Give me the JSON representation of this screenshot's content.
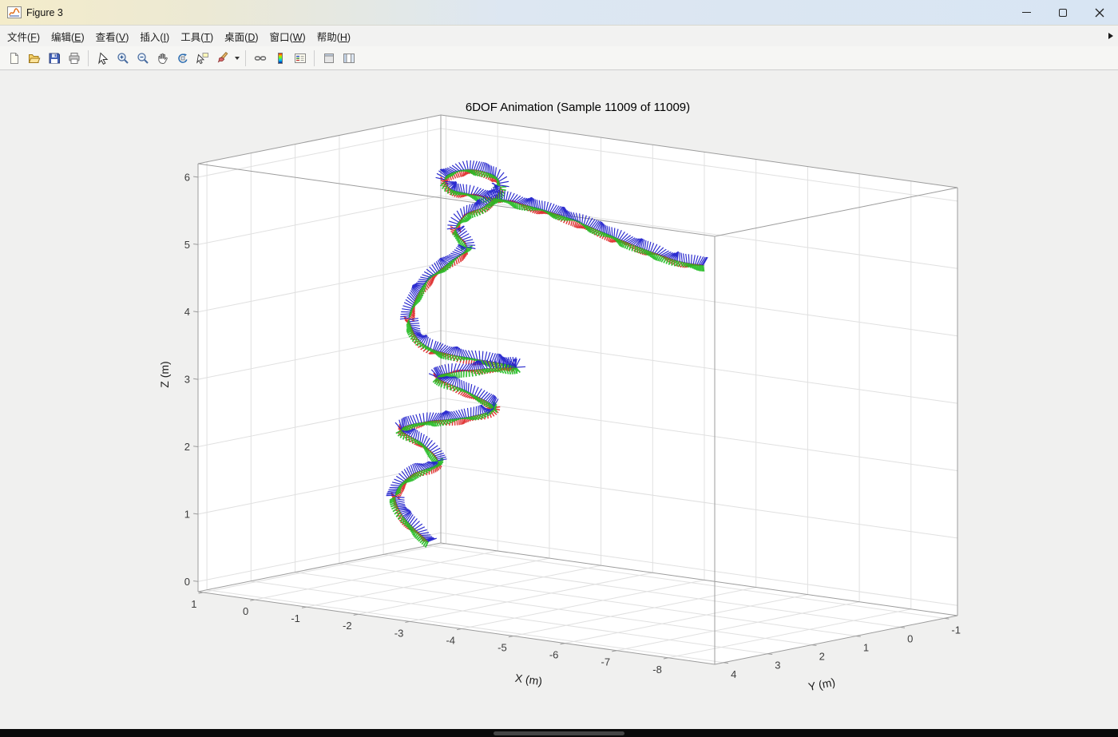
{
  "window": {
    "title": "Figure 3",
    "controls": [
      "minimize",
      "maximize",
      "close"
    ]
  },
  "menu_bar": {
    "items": [
      {
        "label": "文件(F)"
      },
      {
        "label": "编辑(E)"
      },
      {
        "label": "查看(V)"
      },
      {
        "label": "插入(I)"
      },
      {
        "label": "工具(T)"
      },
      {
        "label": "桌面(D)"
      },
      {
        "label": "窗口(W)"
      },
      {
        "label": "帮助(H)"
      }
    ]
  },
  "toolbar": {
    "icons": [
      "new-figure",
      "open-file",
      "save-figure",
      "print-figure",
      "edit-plot",
      "zoom-in",
      "zoom-out",
      "pan",
      "rotate-3d",
      "data-cursor",
      "brush-data",
      "link-plot",
      "insert-colorbar",
      "insert-legend",
      "hide-plot-tools",
      "show-plot-tools"
    ]
  },
  "colors": {
    "titlebar_gradient_left": "#f4ecca",
    "titlebar_gradient_right": "#d8e5f3",
    "figure_background": "#f0f0ef",
    "axes_background": "#ffffff",
    "grid": "#e0e0e0"
  },
  "chart_data": {
    "type": "scatter",
    "subtype": "3d-pose-trail",
    "title": "6DOF Animation (Sample 11009 of 11009)",
    "sample_current": 11009,
    "sample_total": 11009,
    "xlabel": "X (m)",
    "ylabel": "Y (m)",
    "zlabel": "Z (m)",
    "xlim": [
      1.1,
      -8.9
    ],
    "ylim": [
      4.2,
      -1.3
    ],
    "zlim": [
      -0.15,
      6.2
    ],
    "x_ticks": [
      1,
      0,
      -1,
      -2,
      -3,
      -4,
      -5,
      -6,
      -7,
      -8
    ],
    "y_ticks": [
      4,
      3,
      2,
      1,
      0,
      -1
    ],
    "z_ticks": [
      0,
      1,
      2,
      3,
      4,
      5,
      6
    ],
    "grid": true,
    "view": "MATLAB default 3D (az -37.5, el 30)",
    "legend": "none",
    "axes_colors": {
      "x_triad": "#dd2222",
      "y_triad": "#22bb22",
      "z_triad": "#2222cc"
    },
    "trajectory": [
      [
        -0.83,
        1.23,
        0.4
      ],
      [
        -0.39,
        1.3,
        0.75
      ],
      [
        -0.17,
        1.21,
        1.05
      ],
      [
        -0.43,
        1.14,
        1.35
      ],
      [
        -0.84,
        1.04,
        1.55
      ],
      [
        -0.57,
        1.05,
        1.8
      ],
      [
        -0.23,
        1.15,
        2.0
      ],
      [
        -0.84,
        1.29,
        2.2
      ],
      [
        -1.63,
        1.32,
        2.35
      ],
      [
        -1.96,
        1.08,
        2.5
      ],
      [
        -1.48,
        1.14,
        2.7
      ],
      [
        -0.88,
        1.09,
        2.85
      ],
      [
        -1.56,
        0.82,
        3.0
      ],
      [
        -1.95,
        0.6,
        3.05
      ],
      [
        -0.85,
        1.15,
        3.25
      ],
      [
        -0.45,
        1.21,
        3.6
      ],
      [
        -0.37,
        1.01,
        3.9
      ],
      [
        -0.54,
        0.94,
        4.2
      ],
      [
        -0.71,
        0.65,
        4.45
      ],
      [
        -1.02,
        0.6,
        4.7
      ],
      [
        -0.79,
        0.57,
        4.95
      ],
      [
        -1.0,
        0.58,
        5.2
      ],
      [
        -1.71,
        1.0,
        5.45
      ],
      [
        -1.97,
        0.97,
        5.7
      ],
      [
        -1.66,
        0.7,
        5.85
      ],
      [
        -1.37,
        0.93,
        5.95
      ],
      [
        -1.29,
        1.38,
        5.9
      ],
      [
        -1.48,
        1.5,
        5.75
      ],
      [
        -1.7,
        1.24,
        5.65
      ],
      [
        -2.0,
        0.85,
        5.55
      ],
      [
        -2.27,
        0.43,
        5.4
      ],
      [
        -2.83,
        0.36,
        5.3
      ],
      [
        -3.39,
        0.28,
        5.15
      ],
      [
        -3.95,
        0.2,
        5.0
      ],
      [
        -4.7,
        0.13,
        4.85
      ],
      [
        -5.15,
        0.05,
        4.82
      ]
    ]
  }
}
